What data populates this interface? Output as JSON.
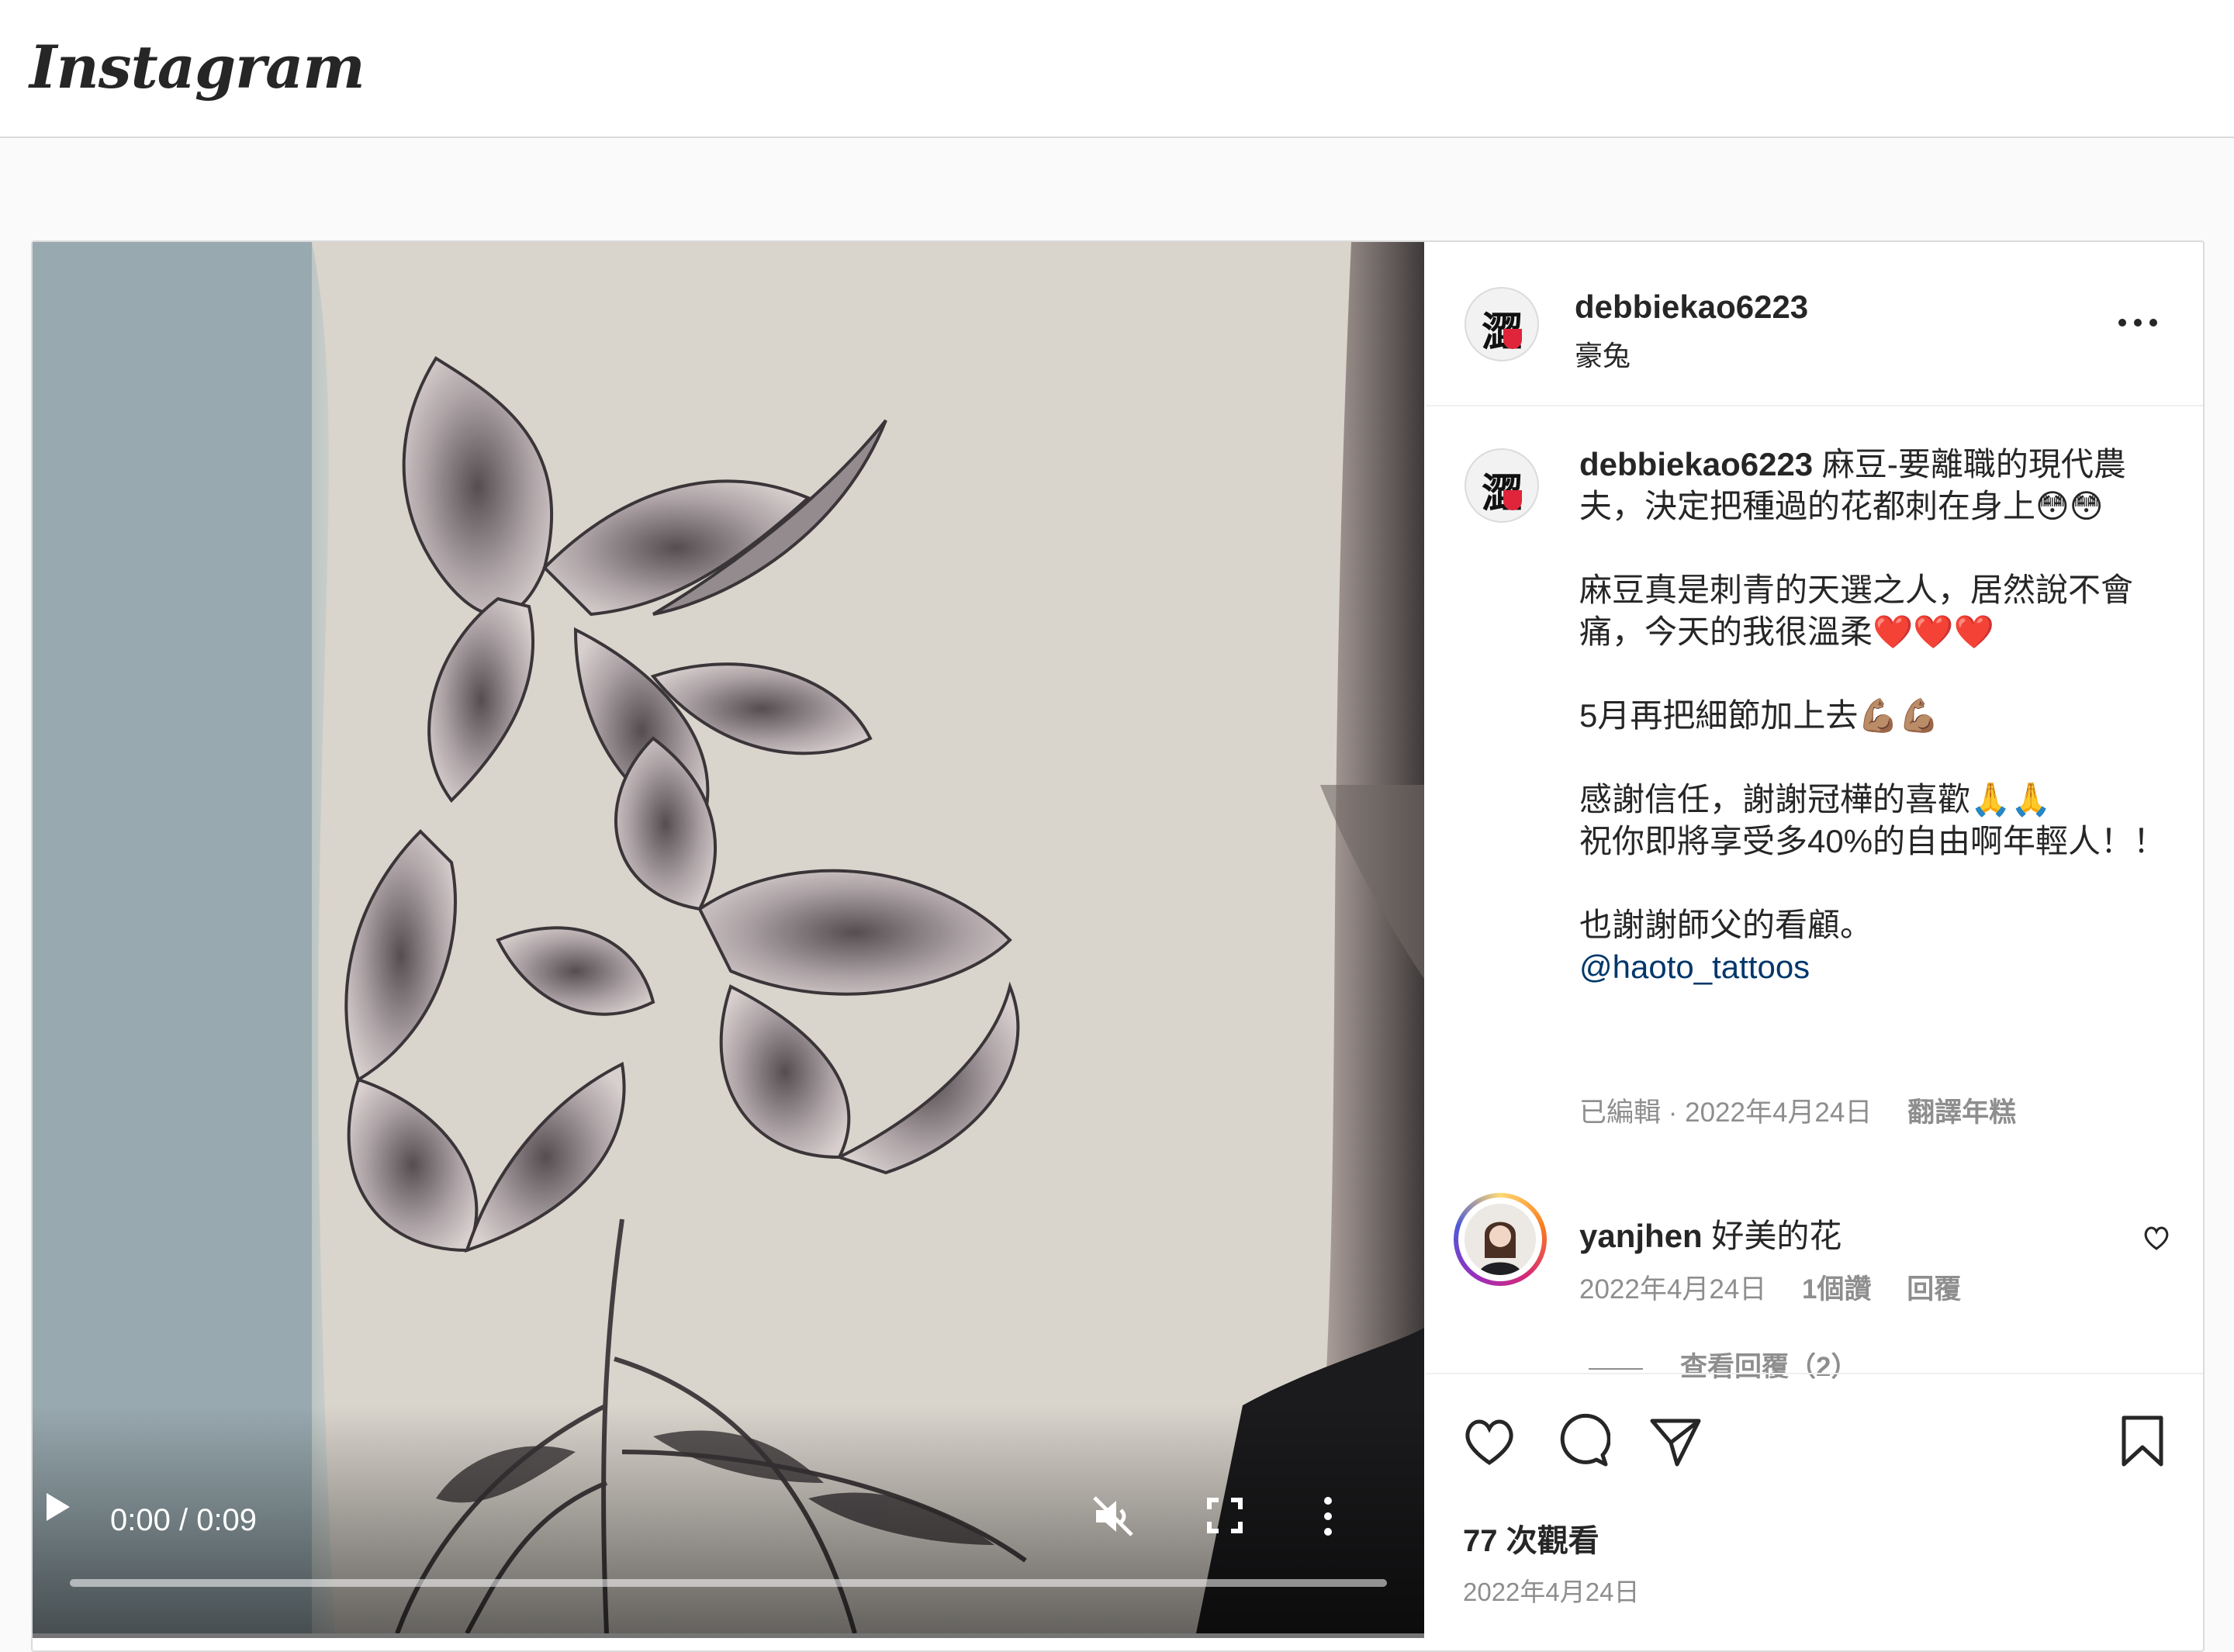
{
  "header": {
    "logo": "Instagram"
  },
  "post": {
    "author": {
      "username": "debbiekao6223",
      "subtitle": "豪兔"
    },
    "caption": {
      "username": "debbiekao6223",
      "text": " 麻豆-要離職的現代農夫，決定把種過的花都刺在身上😳😳\n\n麻豆真是刺青的天選之人，居然說不會痛，今天的我很溫柔❤️❤️❤️\n\n5月再把細節加上去💪🏽💪🏽\n\n感謝信任，謝謝冠樺的喜歡🙏🙏\n祝你即將享受多40%的自由啊年輕人！！\n\n也謝謝師父的看顧。\n",
      "mention": "@haoto_tattoos"
    },
    "caption_meta": {
      "edited": "已編輯 · 2022年4月24日",
      "see_translation": "翻譯年糕"
    },
    "comment": {
      "username": "yanjhen",
      "text": "好美的花",
      "date": "2022年4月24日",
      "likes": "1個讚",
      "reply": "回覆",
      "view_replies": "查看回覆（2）"
    },
    "views": "77 次觀看",
    "date": "2022年4月24日"
  },
  "video": {
    "time": "0:00 / 0:09",
    "progress": 0
  },
  "icons": {
    "play": "play-icon",
    "mute": "muted-speaker-icon",
    "fullscreen": "fullscreen-icon",
    "more_vertical": "more-vertical-icon",
    "more_horizontal": "more-horizontal-icon",
    "like": "heart-icon",
    "comment": "comment-bubble-icon",
    "share": "paper-plane-icon",
    "save": "bookmark-icon"
  }
}
